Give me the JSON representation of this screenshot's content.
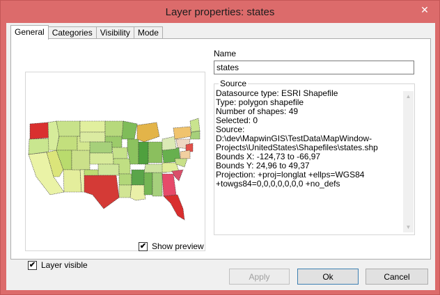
{
  "window": {
    "title": "Layer properties: states",
    "close_glyph": "✕"
  },
  "tabs": [
    {
      "label": "General",
      "active": true
    },
    {
      "label": "Categories",
      "active": false
    },
    {
      "label": "Visibility",
      "active": false
    },
    {
      "label": "Mode",
      "active": false
    }
  ],
  "general": {
    "name_label": "Name",
    "name_value": "states",
    "source_legend": "Source",
    "source_text": "Datasource type: ESRI Shapefile\nType: polygon shapefile\nNumber of shapes: 49\nSelected: 0\nSource: D:\\dev\\MapwinGIS\\TestData\\MapWindow-Projects\\UnitedStates\\Shapefiles\\states.shp\nBounds X: -124,73 to -66,97\nBounds Y: 24,96 to 49,37\nProjection: +proj=longlat +ellps=WGS84 +towgs84=0,0,0,0,0,0,0 +no_defs",
    "layer_visible_label": "Layer visible",
    "layer_visible_checked": true,
    "show_preview_label": "Show preview",
    "show_preview_checked": true,
    "check_glyph": "✔"
  },
  "buttons": {
    "apply": "Apply",
    "ok": "Ok",
    "cancel": "Cancel"
  },
  "colors": {
    "title_bar": "#dc6b6b",
    "map_low": "#e8f5b0",
    "map_high": "#d9302f",
    "map_mid": "#5fa847"
  },
  "icons": {
    "close": "close-icon",
    "check": "check-icon",
    "scroll_up": "scroll-up-icon",
    "scroll_down": "scroll-down-icon"
  },
  "scroll_glyphs": {
    "up": "▲",
    "down": "▼"
  }
}
